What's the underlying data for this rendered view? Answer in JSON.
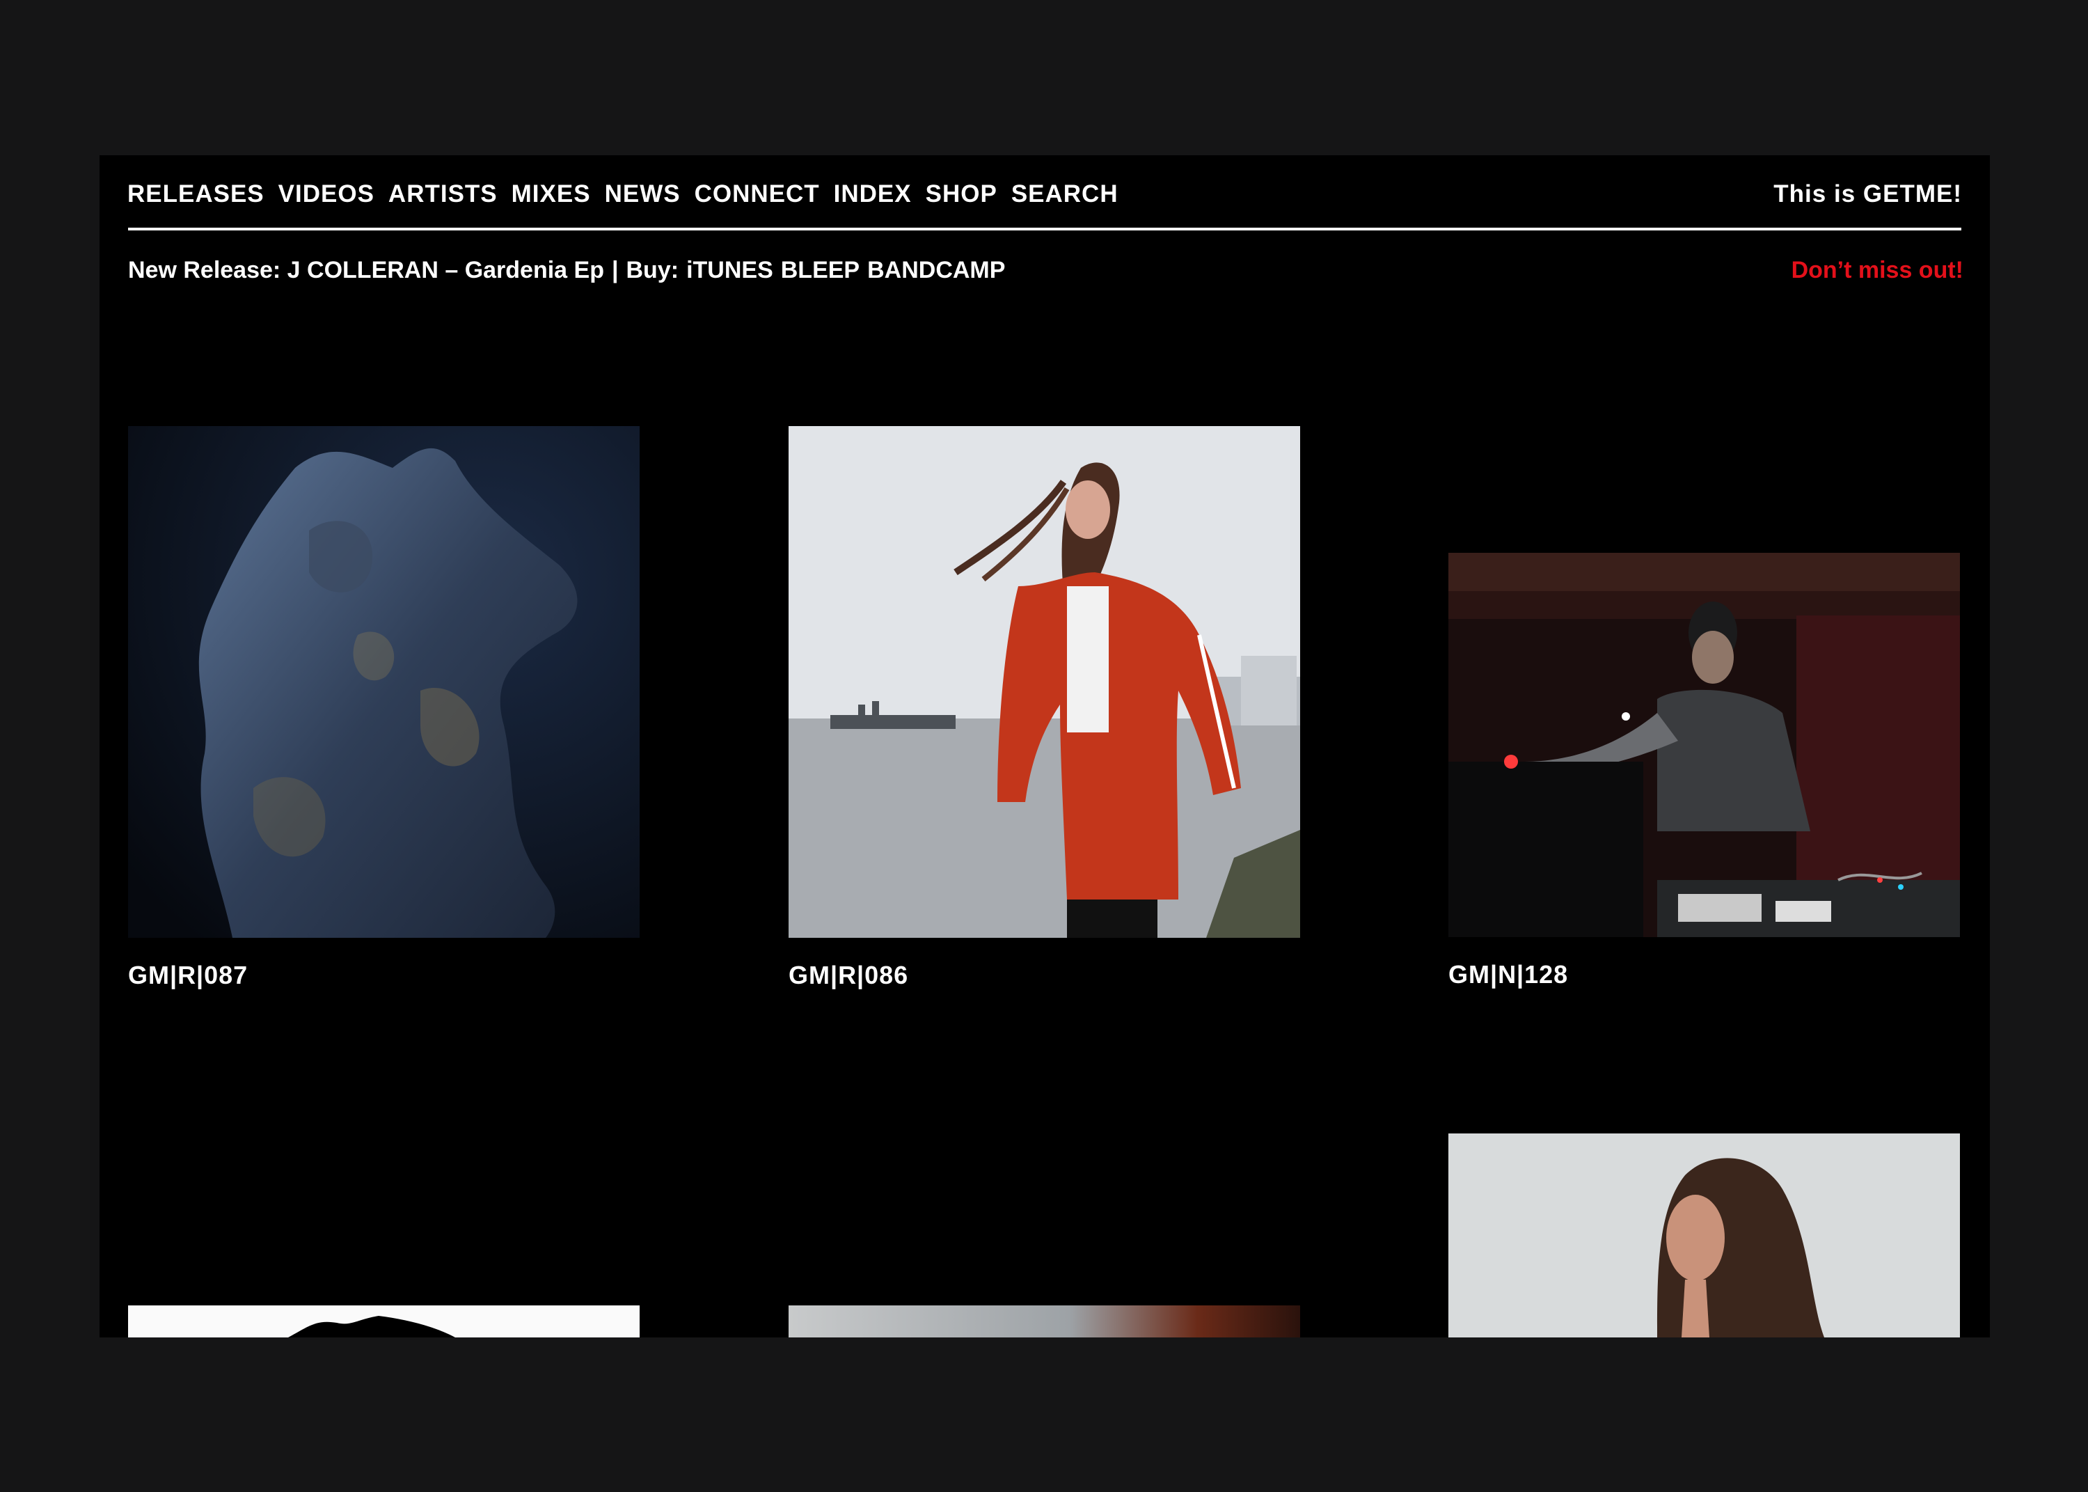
{
  "nav": {
    "items": [
      "RELEASES",
      "VIDEOS",
      "ARTISTS",
      "MIXES",
      "NEWS",
      "CONNECT",
      "INDEX",
      "SHOP",
      "SEARCH"
    ],
    "tagline": "This is GETME!"
  },
  "announcement": {
    "prefix": "New Release: J COLLERAN – Gardenia Ep",
    "separator": "|",
    "buy_label": "Buy:",
    "links": [
      "iTUNES",
      "BLEEP",
      "BANDCAMP"
    ],
    "cta": "Don’t miss out!",
    "cta_color": "#e3101a"
  },
  "grid": {
    "items": [
      {
        "code": "GM|R|087",
        "image": "dark-sculpture-photo"
      },
      {
        "code": "GM|R|086",
        "image": "woman-red-jacket-riverside-photo"
      },
      {
        "code": "GM|N|128",
        "image": "artist-performing-live-photo"
      },
      {
        "code": "",
        "image": "black-white-artwork-photo"
      },
      {
        "code": "",
        "image": "blurred-photo"
      },
      {
        "code": "",
        "image": "woman-portrait-photo"
      }
    ]
  }
}
